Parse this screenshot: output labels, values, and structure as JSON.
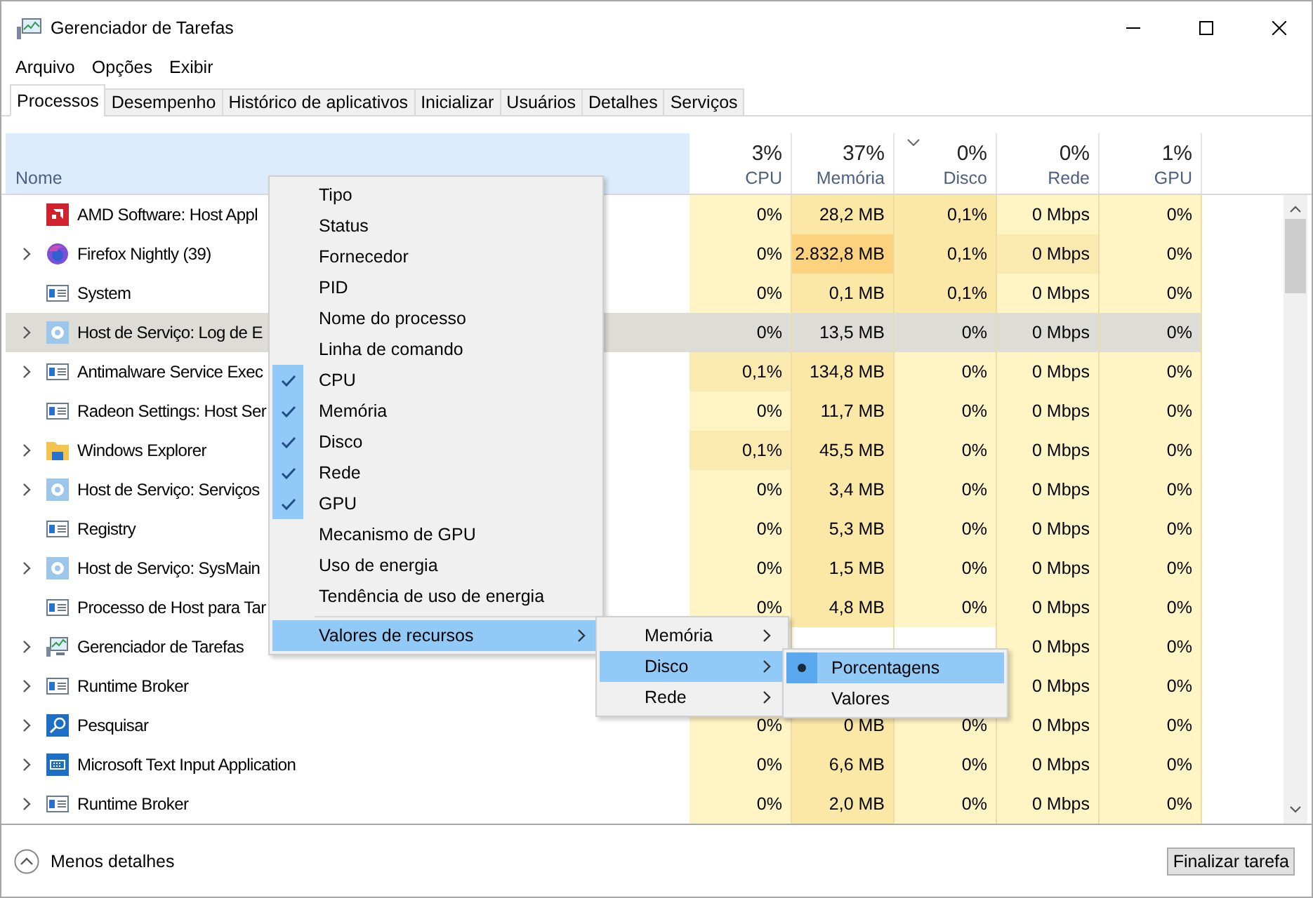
{
  "window": {
    "title": "Gerenciador de Tarefas"
  },
  "menu_bar": [
    "Arquivo",
    "Opções",
    "Exibir"
  ],
  "tabs": [
    {
      "label": "Processos",
      "selected": true
    },
    {
      "label": "Desempenho",
      "selected": false
    },
    {
      "label": "Histórico de aplicativos",
      "selected": false
    },
    {
      "label": "Inicializar",
      "selected": false
    },
    {
      "label": "Usuários",
      "selected": false
    },
    {
      "label": "Detalhes",
      "selected": false
    },
    {
      "label": "Serviços",
      "selected": false
    }
  ],
  "table": {
    "name_column": "Nome",
    "columns": [
      {
        "percent": "3%",
        "label": "CPU",
        "sorted": false
      },
      {
        "percent": "37%",
        "label": "Memória",
        "sorted": false
      },
      {
        "percent": "0%",
        "label": "Disco",
        "sorted": true
      },
      {
        "percent": "0%",
        "label": "Rede",
        "sorted": false
      },
      {
        "percent": "1%",
        "label": "GPU",
        "sorted": false
      }
    ],
    "rows": [
      {
        "name": "AMD Software: Host Appl",
        "expandable": false,
        "kind": "amd",
        "selected": false,
        "cells": [
          {
            "text": "0%",
            "color": "#fff4c4"
          },
          {
            "text": "28,2 MB",
            "color": "#fbe8a6"
          },
          {
            "text": "0,1%",
            "color": "#fbe8a6"
          },
          {
            "text": "0 Mbps",
            "color": "#fff4c4"
          },
          {
            "text": "0%",
            "color": "#fff4c4"
          }
        ]
      },
      {
        "name": "Firefox Nightly (39)",
        "expandable": true,
        "kind": "firefox",
        "selected": false,
        "cells": [
          {
            "text": "0%",
            "color": "#fff4c4"
          },
          {
            "text": "2.832,8 MB",
            "color": "#fcd27e"
          },
          {
            "text": "0,1%",
            "color": "#fbe8a6"
          },
          {
            "text": "0 Mbps",
            "color": "#fbeab0"
          },
          {
            "text": "0%",
            "color": "#fff4c4"
          }
        ]
      },
      {
        "name": "System",
        "expandable": false,
        "kind": "window",
        "selected": false,
        "cells": [
          {
            "text": "0%",
            "color": "#fff4c4"
          },
          {
            "text": "0,1 MB",
            "color": "#fbe8a6"
          },
          {
            "text": "0,1%",
            "color": "#fbe8a6"
          },
          {
            "text": "0 Mbps",
            "color": "#fff4c4"
          },
          {
            "text": "0%",
            "color": "#fff4c4"
          }
        ]
      },
      {
        "name": "Host de Serviço: Log de E",
        "expandable": true,
        "kind": "gear",
        "selected": true,
        "cells": [
          {
            "text": "0%",
            "color": "#dedcd6"
          },
          {
            "text": "13,5 MB",
            "color": "#dedcd6"
          },
          {
            "text": "0%",
            "color": "#dedcd6"
          },
          {
            "text": "0 Mbps",
            "color": "#dedcd6"
          },
          {
            "text": "0%",
            "color": "#dedcd6"
          }
        ]
      },
      {
        "name": "Antimalware Service Exec",
        "expandable": true,
        "kind": "window",
        "selected": false,
        "cells": [
          {
            "text": "0,1%",
            "color": "#fbeab0"
          },
          {
            "text": "134,8 MB",
            "color": "#fbe8a6"
          },
          {
            "text": "0%",
            "color": "#fff4c4"
          },
          {
            "text": "0 Mbps",
            "color": "#fff4c4"
          },
          {
            "text": "0%",
            "color": "#fff4c4"
          }
        ]
      },
      {
        "name": "Radeon Settings: Host Ser",
        "expandable": false,
        "kind": "window",
        "selected": false,
        "cells": [
          {
            "text": "0%",
            "color": "#fff4c4"
          },
          {
            "text": "11,7 MB",
            "color": "#fbe8a6"
          },
          {
            "text": "0%",
            "color": "#fff4c4"
          },
          {
            "text": "0 Mbps",
            "color": "#fff4c4"
          },
          {
            "text": "0%",
            "color": "#fff4c4"
          }
        ]
      },
      {
        "name": "Windows Explorer",
        "expandable": true,
        "kind": "folder",
        "selected": false,
        "cells": [
          {
            "text": "0,1%",
            "color": "#fbeab0"
          },
          {
            "text": "45,5 MB",
            "color": "#fbe8a6"
          },
          {
            "text": "0%",
            "color": "#fff4c4"
          },
          {
            "text": "0 Mbps",
            "color": "#fff4c4"
          },
          {
            "text": "0%",
            "color": "#fff4c4"
          }
        ]
      },
      {
        "name": "Host de Serviço: Serviços",
        "expandable": true,
        "kind": "gear",
        "selected": false,
        "cells": [
          {
            "text": "0%",
            "color": "#fff4c4"
          },
          {
            "text": "3,4 MB",
            "color": "#fbe8a6"
          },
          {
            "text": "0%",
            "color": "#fff4c4"
          },
          {
            "text": "0 Mbps",
            "color": "#fff4c4"
          },
          {
            "text": "0%",
            "color": "#fff4c4"
          }
        ]
      },
      {
        "name": "Registry",
        "expandable": false,
        "kind": "window",
        "selected": false,
        "cells": [
          {
            "text": "0%",
            "color": "#fff4c4"
          },
          {
            "text": "5,3 MB",
            "color": "#fbe8a6"
          },
          {
            "text": "0%",
            "color": "#fff4c4"
          },
          {
            "text": "0 Mbps",
            "color": "#fff4c4"
          },
          {
            "text": "0%",
            "color": "#fff4c4"
          }
        ]
      },
      {
        "name": "Host de Serviço: SysMain",
        "expandable": true,
        "kind": "gear",
        "selected": false,
        "cells": [
          {
            "text": "0%",
            "color": "#fff4c4"
          },
          {
            "text": "1,5 MB",
            "color": "#fbe8a6"
          },
          {
            "text": "0%",
            "color": "#fff4c4"
          },
          {
            "text": "0 Mbps",
            "color": "#fff4c4"
          },
          {
            "text": "0%",
            "color": "#fff4c4"
          }
        ]
      },
      {
        "name": "Processo de Host para Tar",
        "expandable": false,
        "kind": "window",
        "selected": false,
        "cells": [
          {
            "text": "0%",
            "color": "#fff4c4"
          },
          {
            "text": "4,8 MB",
            "color": "#fbe8a6"
          },
          {
            "text": "0%",
            "color": "#fff4c4"
          },
          {
            "text": "0 Mbps",
            "color": "#fff4c4"
          },
          {
            "text": "0%",
            "color": "#fff4c4"
          }
        ]
      },
      {
        "name": "Gerenciador de Tarefas",
        "expandable": true,
        "kind": "monitor",
        "selected": false,
        "cells": [
          null,
          null,
          null,
          {
            "text": "0 Mbps",
            "color": "#fff4c4"
          },
          {
            "text": "0%",
            "color": "#fff4c4"
          }
        ]
      },
      {
        "name": "Runtime Broker",
        "expandable": true,
        "kind": "window",
        "selected": false,
        "cells": [
          null,
          null,
          null,
          {
            "text": "0 Mbps",
            "color": "#fff4c4"
          },
          {
            "text": "0%",
            "color": "#fff4c4"
          }
        ]
      },
      {
        "name": "Pesquisar",
        "expandable": true,
        "kind": "search",
        "selected": false,
        "cells": [
          {
            "text": "0%",
            "color": "#fff4c4"
          },
          {
            "text": "0 MB",
            "color": "#fbe8a6"
          },
          {
            "text": "0%",
            "color": "#fff4c4"
          },
          {
            "text": "0 Mbps",
            "color": "#fff4c4"
          },
          {
            "text": "0%",
            "color": "#fff4c4"
          }
        ]
      },
      {
        "name": "Microsoft Text Input Application",
        "expandable": true,
        "kind": "keyboard",
        "selected": false,
        "cells": [
          {
            "text": "0%",
            "color": "#fff4c4"
          },
          {
            "text": "6,6 MB",
            "color": "#fbe8a6"
          },
          {
            "text": "0%",
            "color": "#fff4c4"
          },
          {
            "text": "0 Mbps",
            "color": "#fff4c4"
          },
          {
            "text": "0%",
            "color": "#fff4c4"
          }
        ]
      },
      {
        "name": "Runtime Broker",
        "expandable": true,
        "kind": "window",
        "selected": false,
        "cells": [
          {
            "text": "0%",
            "color": "#fff4c4"
          },
          {
            "text": "2,0 MB",
            "color": "#fbe8a6"
          },
          {
            "text": "0%",
            "color": "#fff4c4"
          },
          {
            "text": "0 Mbps",
            "color": "#fff4c4"
          },
          {
            "text": "0%",
            "color": "#fff4c4"
          }
        ]
      }
    ]
  },
  "context_menu": {
    "items": [
      {
        "label": "Tipo",
        "checked": false
      },
      {
        "label": "Status",
        "checked": false
      },
      {
        "label": "Fornecedor",
        "checked": false
      },
      {
        "label": "PID",
        "checked": false
      },
      {
        "label": "Nome do processo",
        "checked": false
      },
      {
        "label": "Linha de comando",
        "checked": false
      },
      {
        "label": "CPU",
        "checked": true
      },
      {
        "label": "Memória",
        "checked": true
      },
      {
        "label": "Disco",
        "checked": true
      },
      {
        "label": "Rede",
        "checked": true
      },
      {
        "label": "GPU",
        "checked": true
      },
      {
        "label": "Mecanismo de GPU",
        "checked": false
      },
      {
        "label": "Uso de energia",
        "checked": false
      },
      {
        "label": "Tendência de uso de energia",
        "checked": false
      }
    ],
    "submenu_item": {
      "label": "Valores de recursos",
      "selected": true
    },
    "submenu": [
      {
        "label": "Memória",
        "selected": false
      },
      {
        "label": "Disco",
        "selected": true
      },
      {
        "label": "Rede",
        "selected": false
      }
    ],
    "options": [
      {
        "label": "Porcentagens",
        "selected": true
      },
      {
        "label": "Valores",
        "selected": false
      }
    ]
  },
  "footer": {
    "details_link": "Menos detalhes",
    "end_task_button": "Finalizar tarefa"
  }
}
